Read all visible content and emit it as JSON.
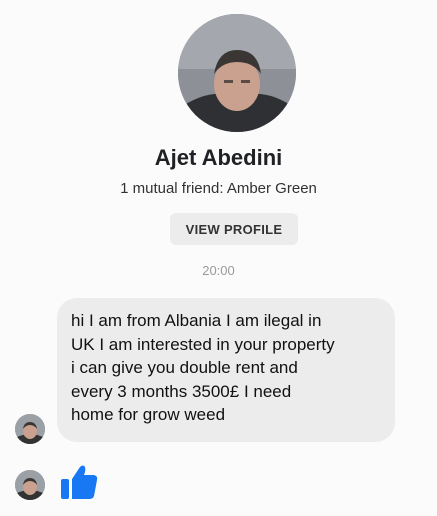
{
  "profile": {
    "name": "Ajet Abedini",
    "mutual": "1 mutual friend: Amber Green",
    "view_profile_label": "VIEW PROFILE"
  },
  "conversation": {
    "time": "20:00",
    "message_lines": [
      "hi I am from Albania I am ilegal in",
      "UK I am interested in your property",
      "i can give you double rent and",
      "every 3 months 3500£ I need",
      "home for grow weed"
    ],
    "reaction_icon": "thumbs-up-icon"
  },
  "colors": {
    "accent": "#1877f2",
    "bubble": "#ececec",
    "button": "#ececec",
    "background": "#fbfbfb"
  }
}
